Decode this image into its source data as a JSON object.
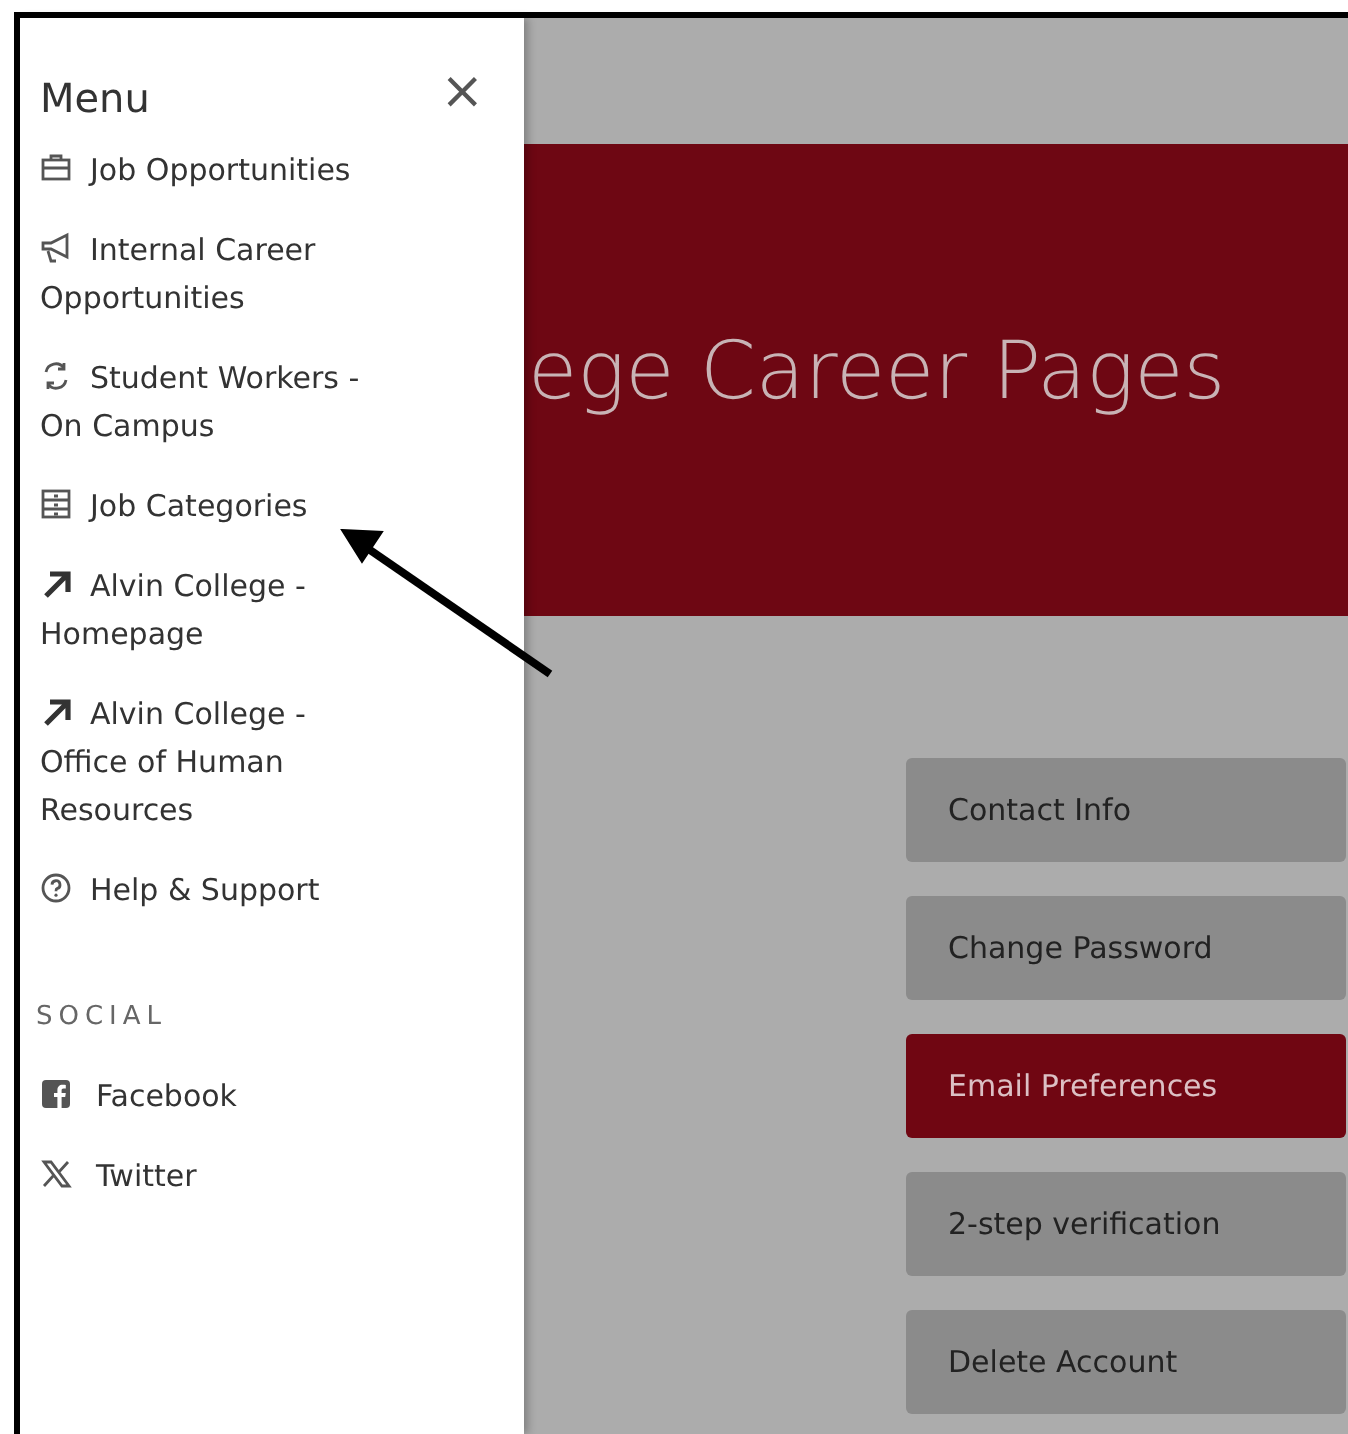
{
  "menu": {
    "title": "Menu",
    "close": "×",
    "items": [
      {
        "kind": "briefcase",
        "label": "Job Opportunities"
      },
      {
        "kind": "megaphone",
        "label": "Internal Career Opportunities"
      },
      {
        "kind": "swap",
        "label": "Student Workers - On Campus"
      },
      {
        "kind": "list",
        "label": "Job Categories"
      },
      {
        "kind": "external",
        "label": "Alvin College - Homepage"
      },
      {
        "kind": "external",
        "label": "Alvin College - Office of Human Resources"
      },
      {
        "kind": "help",
        "label": "Help & Support"
      }
    ]
  },
  "social": {
    "heading": "SOCIAL",
    "items": [
      {
        "kind": "facebook",
        "label": "Facebook"
      },
      {
        "kind": "x",
        "label": "Twitter"
      }
    ]
  },
  "banner": {
    "title": "ege Career Pages"
  },
  "account_buttons": [
    {
      "label": "Contact Info",
      "selected": false
    },
    {
      "label": "Change Password",
      "selected": false
    },
    {
      "label": "Email Preferences",
      "selected": true
    },
    {
      "label": "2-step verification",
      "selected": false
    },
    {
      "label": "Delete Account",
      "selected": false
    }
  ]
}
